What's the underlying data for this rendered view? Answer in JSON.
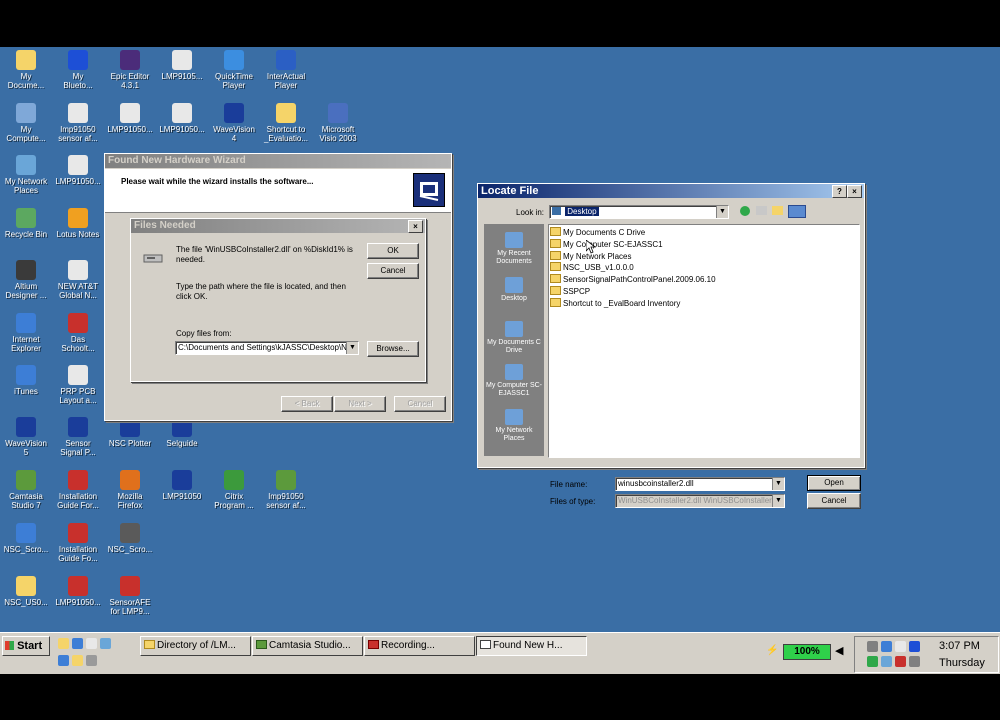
{
  "desktop_icons": [
    {
      "l1": "My",
      "l2": "Docume...",
      "icon": "documents-folder-icon",
      "color": "#f5d469"
    },
    {
      "l1": "My",
      "l2": "Blueto...",
      "icon": "bluetooth-icon",
      "color": "#1d4fd6"
    },
    {
      "l1": "Epic Editor",
      "l2": "4.3.1",
      "icon": "epic-editor-icon",
      "color": "#4b2c7a"
    },
    {
      "l1": "LMP9105...",
      "l2": "",
      "icon": "document-icon",
      "color": "#e8e8e8"
    },
    {
      "l1": "QuickTime",
      "l2": "Player",
      "icon": "quicktime-icon",
      "color": "#3c8ee0"
    },
    {
      "l1": "InterActual",
      "l2": "Player",
      "icon": "interactual-icon",
      "color": "#2b5fc4"
    },
    {
      "l1": "My",
      "l2": "Compute...",
      "icon": "computer-icon",
      "color": "#7fa8d8"
    },
    {
      "l1": "lmp91050",
      "l2": "sensor af...",
      "icon": "document-icon",
      "color": "#e8e8e8"
    },
    {
      "l1": "LMP91050...",
      "l2": "",
      "icon": "document-icon",
      "color": "#e8e8e8"
    },
    {
      "l1": "LMP91050...",
      "l2": "",
      "icon": "document-icon",
      "color": "#e8e8e8"
    },
    {
      "l1": "WaveVision",
      "l2": "4",
      "icon": "wavevision-icon",
      "color": "#1a3d9a"
    },
    {
      "l1": "Shortcut to",
      "l2": "_Evaluatio...",
      "icon": "shortcut-folder-icon",
      "color": "#f5d469"
    },
    {
      "l1": "Microsoft",
      "l2": "Visio 2003",
      "icon": "visio-icon",
      "color": "#4a6fbf"
    },
    {
      "l1": "My Network",
      "l2": "Places",
      "icon": "network-icon",
      "color": "#6aa6d8"
    },
    {
      "l1": "LMP91050...",
      "l2": "",
      "icon": "document-icon",
      "color": "#e8e8e8"
    },
    {
      "l1": "Recycle Bin",
      "l2": "",
      "icon": "recycle-bin-icon",
      "color": "#5ca860"
    },
    {
      "l1": "Lotus Notes",
      "l2": "",
      "icon": "lotus-notes-icon",
      "color": "#f0a020"
    },
    {
      "l1": "Altium",
      "l2": "Designer ...",
      "icon": "altium-icon",
      "color": "#3a3a3a"
    },
    {
      "l1": "NEW AT&T",
      "l2": "Global N...",
      "icon": "document-icon",
      "color": "#e8e8e8"
    },
    {
      "l1": "Internet",
      "l2": "Explorer",
      "icon": "internet-explorer-icon",
      "color": "#3d7ed6"
    },
    {
      "l1": "Das",
      "l2": "Schoolt...",
      "icon": "pdf-icon",
      "color": "#c8302c"
    },
    {
      "l1": "iTunes",
      "l2": "",
      "icon": "itunes-icon",
      "color": "#3d7ed6"
    },
    {
      "l1": "PRP PCB",
      "l2": "Layout a...",
      "icon": "document-icon",
      "color": "#e8e8e8"
    },
    {
      "l1": "WaveVision",
      "l2": "5",
      "icon": "wavevision-icon",
      "color": "#1a3d9a"
    },
    {
      "l1": "Sensor",
      "l2": "Signal P...",
      "icon": "wavevision-icon",
      "color": "#1a3d9a"
    },
    {
      "l1": "NSC Plotter",
      "l2": "",
      "icon": "nsc-plotter-icon",
      "color": "#1a3d9a"
    },
    {
      "l1": "Selguide",
      "l2": "",
      "icon": "selguide-icon",
      "color": "#1a3d9a"
    },
    {
      "l1": "Camtasia",
      "l2": "Studio 7",
      "icon": "camtasia-icon",
      "color": "#5c9a3c"
    },
    {
      "l1": "Installation",
      "l2": "Guide For...",
      "icon": "pdf-icon",
      "color": "#c8302c"
    },
    {
      "l1": "Mozilla",
      "l2": "Firefox",
      "icon": "firefox-icon",
      "color": "#e0701c"
    },
    {
      "l1": "LMP91050",
      "l2": "",
      "icon": "wavevision-icon",
      "color": "#1a3d9a"
    },
    {
      "l1": "Citrix",
      "l2": "Program ...",
      "icon": "citrix-icon",
      "color": "#3c9a3c"
    },
    {
      "l1": "lmp91050",
      "l2": "sensor af...",
      "icon": "camtasia-icon",
      "color": "#5c9a3c"
    },
    {
      "l1": "NSC_Scro...",
      "l2": "",
      "icon": "nsc-scroll-icon",
      "color": "#3d7ed6"
    },
    {
      "l1": "Installation",
      "l2": "Guide Fo...",
      "icon": "pdf-icon",
      "color": "#c8302c"
    },
    {
      "l1": "NSC_Scro...",
      "l2": "",
      "icon": "nsc-scroll-icon",
      "color": "#5a5a5a"
    },
    {
      "l1": "NSC_US0...",
      "l2": "",
      "icon": "folder-icon",
      "color": "#f5d469"
    },
    {
      "l1": "LMP91050...",
      "l2": "",
      "icon": "pdf-icon",
      "color": "#c8302c"
    },
    {
      "l1": "SensorAFE",
      "l2": "for LMP9...",
      "icon": "pdf-icon",
      "color": "#c8302c"
    }
  ],
  "wizard": {
    "title": "Found New Hardware Wizard",
    "heading": "Please wait while the wizard installs the software...",
    "back": "< Back",
    "next": "Next >",
    "cancel": "Cancel"
  },
  "files_needed": {
    "title": "Files Needed",
    "message": "The file 'WinUSBCoInstaller2.dll' on %DiskId1% is needed.",
    "instruction": "Type the path where the file is located, and then click OK.",
    "copy_label": "Copy files from:",
    "path": "C:\\Documents and Settings\\kJASSC\\Desktop\\N",
    "ok": "OK",
    "cancel": "Cancel",
    "browse": "Browse..."
  },
  "locate": {
    "title": "Locate File",
    "help": "?",
    "close": "X",
    "look_in_label": "Look in:",
    "look_in_value": "Desktop",
    "places": [
      {
        "label": "My Recent Documents"
      },
      {
        "label": "Desktop"
      },
      {
        "label": "My Documents C Drive"
      },
      {
        "label": "My Computer SC-EJASSC1"
      },
      {
        "label": "My Network Places"
      }
    ],
    "items": [
      "My Documents C Drive",
      "My Computer SC-EJASSC1",
      "My Network Places",
      "NSC_USB_v1.0.0.0",
      "SensorSignalPathControlPanel.2009.06.10",
      "SSPCP",
      "Shortcut to _EvalBoard Inventory"
    ],
    "filename_label": "File name:",
    "filename_value": "winusbcoinstaller2.dll",
    "filetype_label": "Files of type:",
    "filetype_value": "WinUSBCoInstaller2.dll WinUSBCoInstaller2.dll",
    "open": "Open",
    "cancel": "Cancel"
  },
  "taskbar": {
    "start": "Start",
    "tasks": [
      "Directory of /LM...",
      "Camtasia Studio...",
      "Recording...",
      "Found New H..."
    ],
    "battery": "100%",
    "time": "3:07 PM",
    "day": "Thursday"
  }
}
